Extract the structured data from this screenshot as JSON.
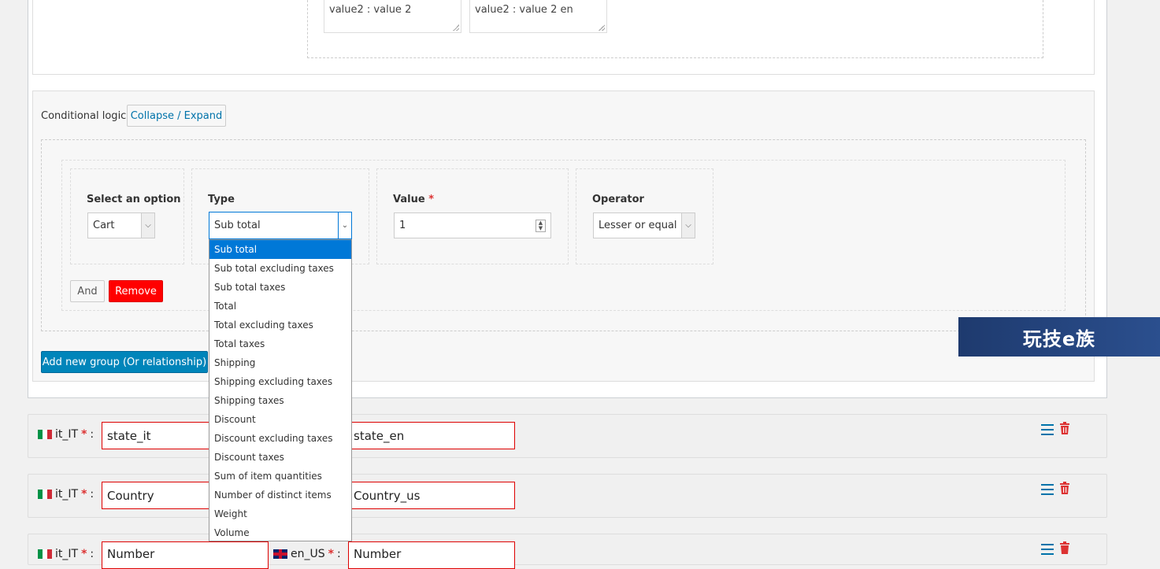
{
  "top_values": {
    "value_it": "value2 : value 2",
    "value_en": "value2 : value 2 en"
  },
  "conditional": {
    "label": "Conditional logic",
    "collapse_label": "Collapse / Expand",
    "select_option": {
      "title": "Select an option",
      "value": "Cart"
    },
    "type": {
      "title": "Type",
      "value": "Sub total",
      "options": [
        "Sub total",
        "Sub total excluding taxes",
        "Sub total taxes",
        "Total",
        "Total excluding taxes",
        "Total taxes",
        "Shipping",
        "Shipping excluding taxes",
        "Shipping taxes",
        "Discount",
        "Discount excluding taxes",
        "Discount taxes",
        "Sum of item quantities",
        "Number of distinct items",
        "Weight",
        "Volume"
      ]
    },
    "value": {
      "title": "Value",
      "required_mark": "*",
      "value": "1"
    },
    "operator": {
      "title": "Operator",
      "value": "Lesser or equal"
    },
    "and_label": "And",
    "remove_label": "Remove",
    "add_group_label": "Add new group (Or relationship)"
  },
  "watermark": "玩技e族",
  "rows": [
    {
      "lang_it": "it_IT",
      "req": "*",
      "sep": ":",
      "value_it": "state_it",
      "value_en": "state_en"
    },
    {
      "lang_it": "it_IT",
      "req": "*",
      "sep": ":",
      "value_it": "Country",
      "value_en": "Country_us"
    },
    {
      "lang_it": "it_IT",
      "req": "*",
      "sep": ":",
      "value_it": "Number",
      "lang_en": "en_US",
      "value_en": "Number"
    }
  ],
  "icons": {
    "menu": "menu-icon",
    "trash": "trash-icon",
    "flag_it": "flag-it-icon",
    "flag_uk": "flag-uk-icon"
  },
  "colors": {
    "accent": "#0073aa",
    "primary_button": "#0085ba",
    "danger": "#ff0000",
    "selected": "#0078d7"
  }
}
